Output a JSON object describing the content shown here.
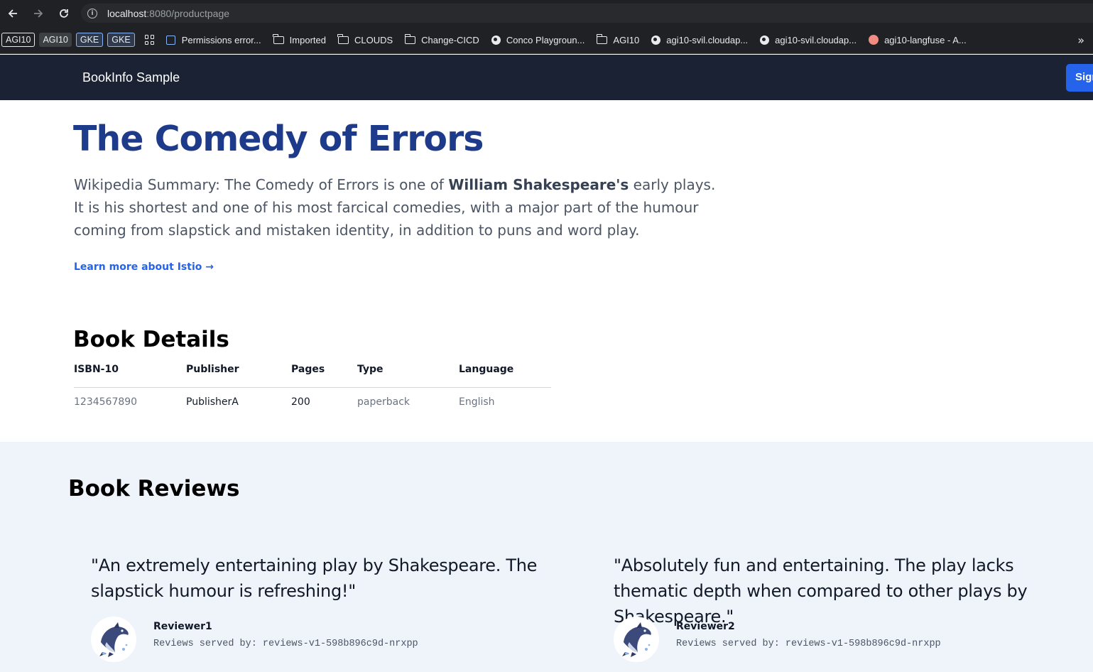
{
  "browser": {
    "url_host": "localhost",
    "url_path": ":8080/productpage",
    "bookmarks": {
      "badges": [
        "AGI10",
        "AGI10",
        "GKE",
        "GKE"
      ],
      "items": [
        {
          "label": "Permissions error...",
          "icon": "chip-icon"
        },
        {
          "label": "Imported",
          "icon": "folder-icon"
        },
        {
          "label": "CLOUDS",
          "icon": "folder-icon"
        },
        {
          "label": "Change-CICD",
          "icon": "folder-icon"
        },
        {
          "label": "Conco Playgroun...",
          "icon": "globe-icon"
        },
        {
          "label": "AGI10",
          "icon": "folder-icon"
        },
        {
          "label": "agi10-svil.cloudap...",
          "icon": "globe-icon"
        },
        {
          "label": "agi10-svil.cloudap...",
          "icon": "globe-icon"
        },
        {
          "label": "agi10-langfuse - A...",
          "icon": "langfuse-icon"
        }
      ]
    }
  },
  "nav": {
    "brand": "BookInfo Sample",
    "signin_label": "Sign in"
  },
  "book": {
    "title": "The Comedy of Errors",
    "summary_prefix": "Wikipedia Summary: The Comedy of Errors is one of ",
    "summary_bold": "William Shakespeare's",
    "summary_suffix": " early plays. It is his shortest and one of his most farcical comedies, with a major part of the humour coming from slapstick and mistaken identity, in addition to puns and word play.",
    "learn_more": "Learn more about Istio →"
  },
  "details": {
    "heading": "Book Details",
    "columns": [
      "ISBN-10",
      "Publisher",
      "Pages",
      "Type",
      "Language"
    ],
    "row": [
      "1234567890",
      "PublisherA",
      "200",
      "paperback",
      "English"
    ]
  },
  "reviews": {
    "heading": "Book Reviews",
    "items": [
      {
        "quote": "\"An extremely entertaining play by Shakespeare. The slapstick humour is refreshing!\"",
        "reviewer": "Reviewer1",
        "served_by": "Reviews served by: reviews-v1-598b896c9d-nrxpp"
      },
      {
        "quote": "\"Absolutely fun and entertaining. The play lacks thematic depth when compared to other plays by Shakespeare.\"",
        "reviewer": "Reviewer2",
        "served_by": "Reviews served by: reviews-v1-598b896c9d-nrxpp"
      }
    ]
  },
  "colors": {
    "title": "#1e3a8a",
    "accent": "#2563eb",
    "nav_bg": "#1a2233",
    "reviews_bg": "#eff4fb"
  }
}
